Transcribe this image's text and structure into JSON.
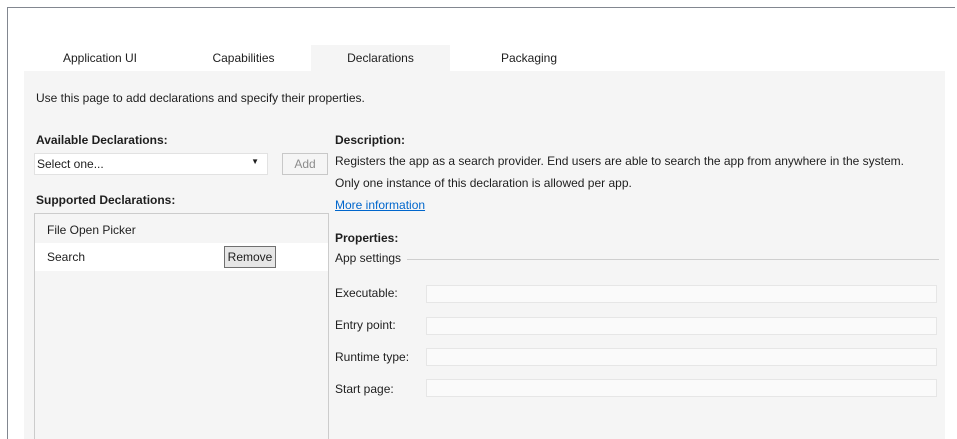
{
  "tabs": [
    {
      "label": "Application UI"
    },
    {
      "label": "Capabilities"
    },
    {
      "label": "Declarations",
      "active": true
    },
    {
      "label": "Packaging"
    }
  ],
  "intro_text": "Use this page to add declarations and specify their properties.",
  "available": {
    "header": "Available Declarations:",
    "select_value": "Select one...",
    "add_label": "Add"
  },
  "supported": {
    "header": "Supported Declarations:",
    "items": [
      {
        "label": "File Open Picker"
      },
      {
        "label": "Search",
        "selected": true,
        "remove_label": "Remove"
      }
    ]
  },
  "description": {
    "header": "Description:",
    "line1": "Registers the app as a search provider. End users are able to search the app from anywhere in the system.",
    "line2": "Only one instance of this declaration is allowed per app.",
    "link": "More information"
  },
  "properties": {
    "header": "Properties:",
    "group_label": "App settings",
    "fields": [
      {
        "label": "Executable:",
        "value": ""
      },
      {
        "label": "Entry point:",
        "value": ""
      },
      {
        "label": "Runtime type:",
        "value": ""
      },
      {
        "label": "Start page:",
        "value": ""
      }
    ]
  },
  "colors": {
    "panel_bg": "#f5f5f5",
    "link": "#0066cc",
    "border": "#cccccc"
  }
}
